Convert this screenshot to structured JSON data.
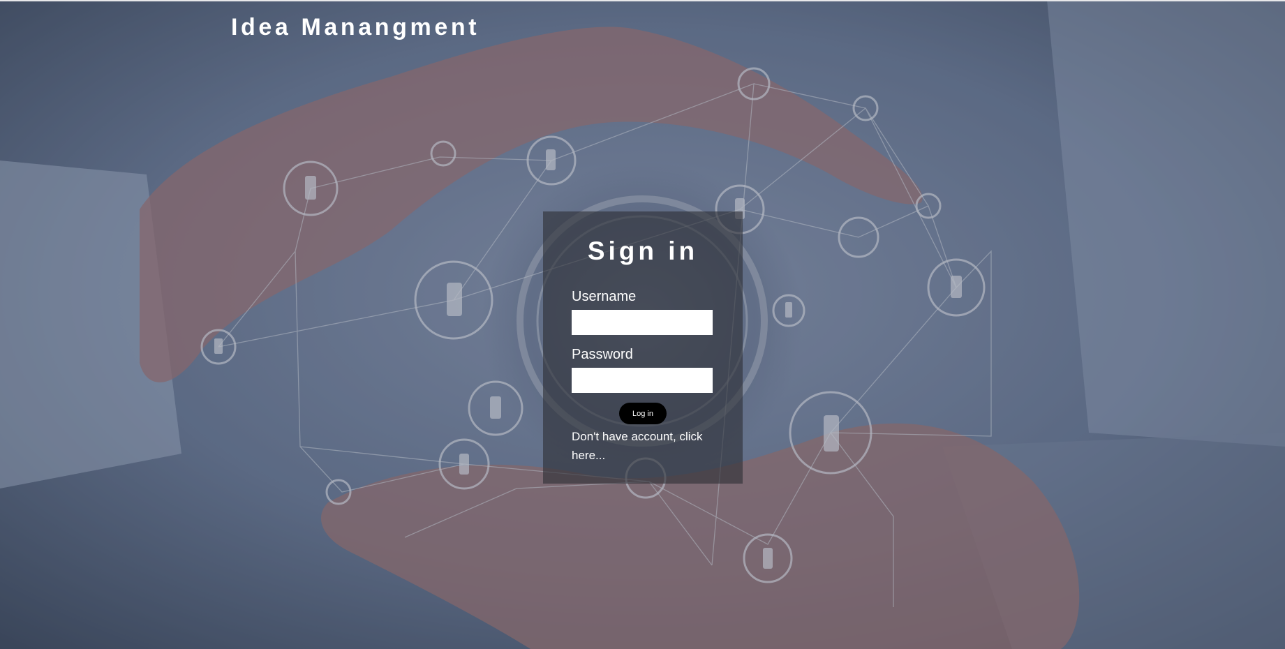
{
  "header": {
    "app_title": "Idea Manangment"
  },
  "login": {
    "title": "Sign in",
    "username_label": "Username",
    "username_value": "",
    "password_label": "Password",
    "password_value": "",
    "submit_label": "Log in",
    "signup_link": "Don't have account, click here..."
  },
  "colors": {
    "card_background": "#2d2f36",
    "button_background": "#000000",
    "text": "#ffffff"
  }
}
